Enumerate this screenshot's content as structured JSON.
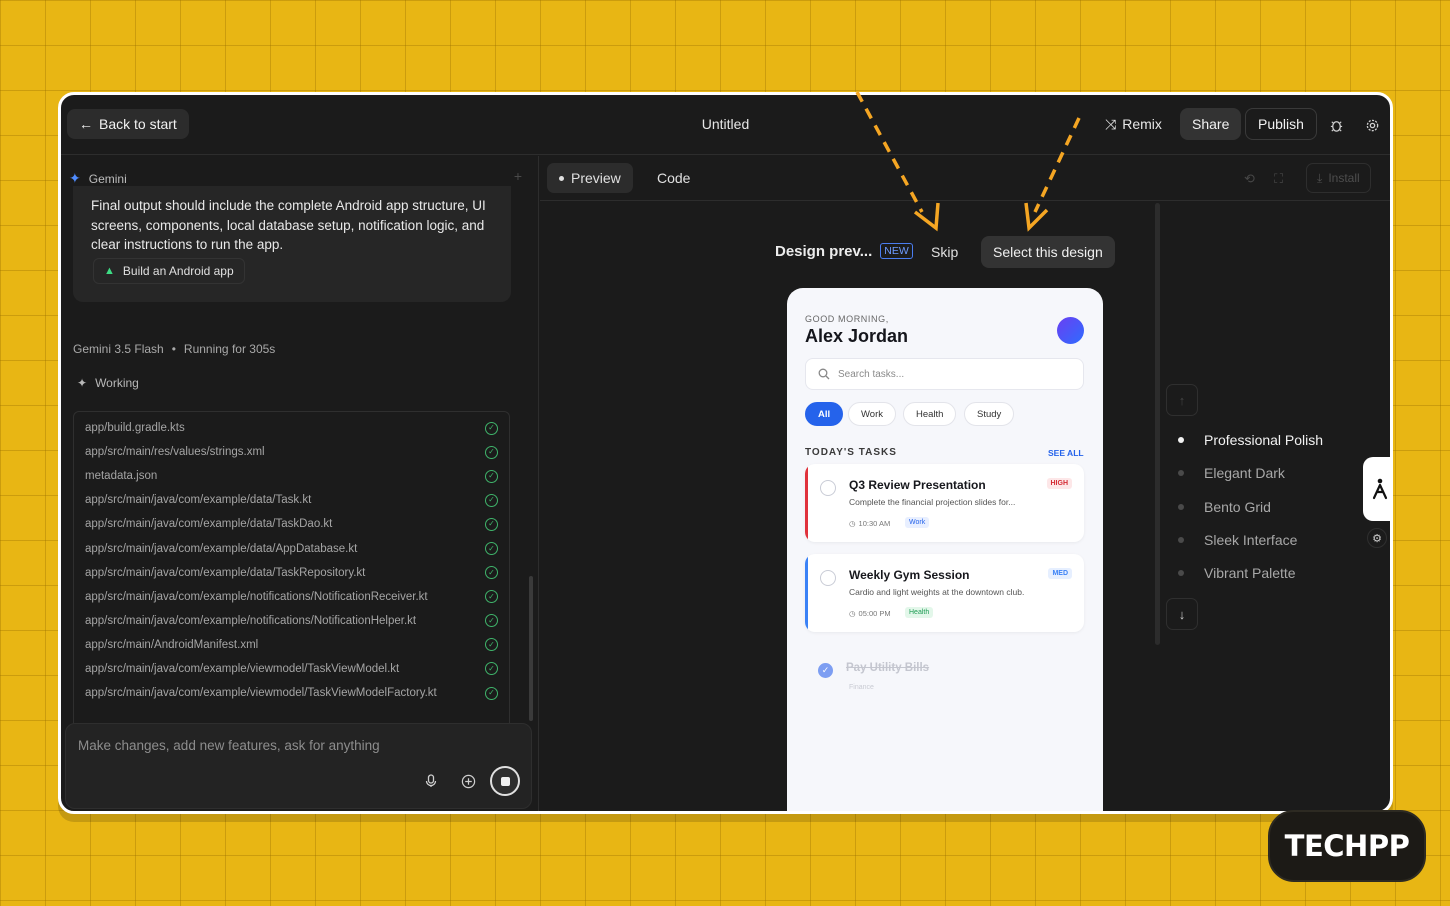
{
  "topbar": {
    "back_label": "Back to start",
    "title": "Untitled",
    "remix_label": "Remix",
    "share_label": "Share",
    "publish_label": "Publish"
  },
  "chat": {
    "agent_name": "Gemini",
    "prompt_text": "Final output should include the complete Android app structure, UI screens, components, local database setup, notification logic, and clear instructions to run the app.",
    "chip_label": "Build an Android app",
    "model": "Gemini 3.5 Flash",
    "running": "Running for 305s",
    "working_label": "Working",
    "files": [
      "app/build.gradle.kts",
      "app/src/main/res/values/strings.xml",
      "metadata.json",
      "app/src/main/java/com/example/data/Task.kt",
      "app/src/main/java/com/example/data/TaskDao.kt",
      "app/src/main/java/com/example/data/AppDatabase.kt",
      "app/src/main/java/com/example/data/TaskRepository.kt",
      "app/src/main/java/com/example/notifications/NotificationReceiver.kt",
      "app/src/main/java/com/example/notifications/NotificationHelper.kt",
      "app/src/main/AndroidManifest.xml",
      "app/src/main/java/com/example/viewmodel/TaskViewModel.kt",
      "app/src/main/java/com/example/viewmodel/TaskViewModelFactory.kt"
    ],
    "composer_placeholder": "Make changes, add new features, ask for anything"
  },
  "tabs": {
    "preview": "Preview",
    "code": "Code",
    "install": "Install"
  },
  "design": {
    "title": "Design prev...",
    "new_badge": "NEW",
    "skip": "Skip",
    "select": "Select this design",
    "options": [
      "Professional Polish",
      "Elegant Dark",
      "Bento Grid",
      "Sleek Interface",
      "Vibrant Palette"
    ],
    "selected_option": "Professional Polish"
  },
  "phone": {
    "greeting": "GOOD MORNING,",
    "user_name": "Alex Jordan",
    "search_placeholder": "Search tasks...",
    "filters": [
      "All",
      "Work",
      "Health",
      "Study"
    ],
    "section_title": "TODAY'S TASKS",
    "see_all": "SEE ALL",
    "tasks": [
      {
        "title": "Q3 Review Presentation",
        "desc": "Complete the financial projection slides for...",
        "time": "10:30 AM",
        "tag": "Work",
        "priority": "HIGH"
      },
      {
        "title": "Weekly Gym Session",
        "desc": "Cardio and light weights at the downtown club.",
        "time": "05:00 PM",
        "tag": "Health",
        "priority": "MED"
      }
    ],
    "done_task": {
      "title": "Pay Utility Bills",
      "tag": "Finance"
    }
  },
  "watermark": "TECHPP",
  "colors": {
    "background": "#e8b614",
    "accent_blue": "#2563eb",
    "high_priority": "#e0323c",
    "med_priority": "#3b82f6",
    "arrow": "#f5a623"
  }
}
